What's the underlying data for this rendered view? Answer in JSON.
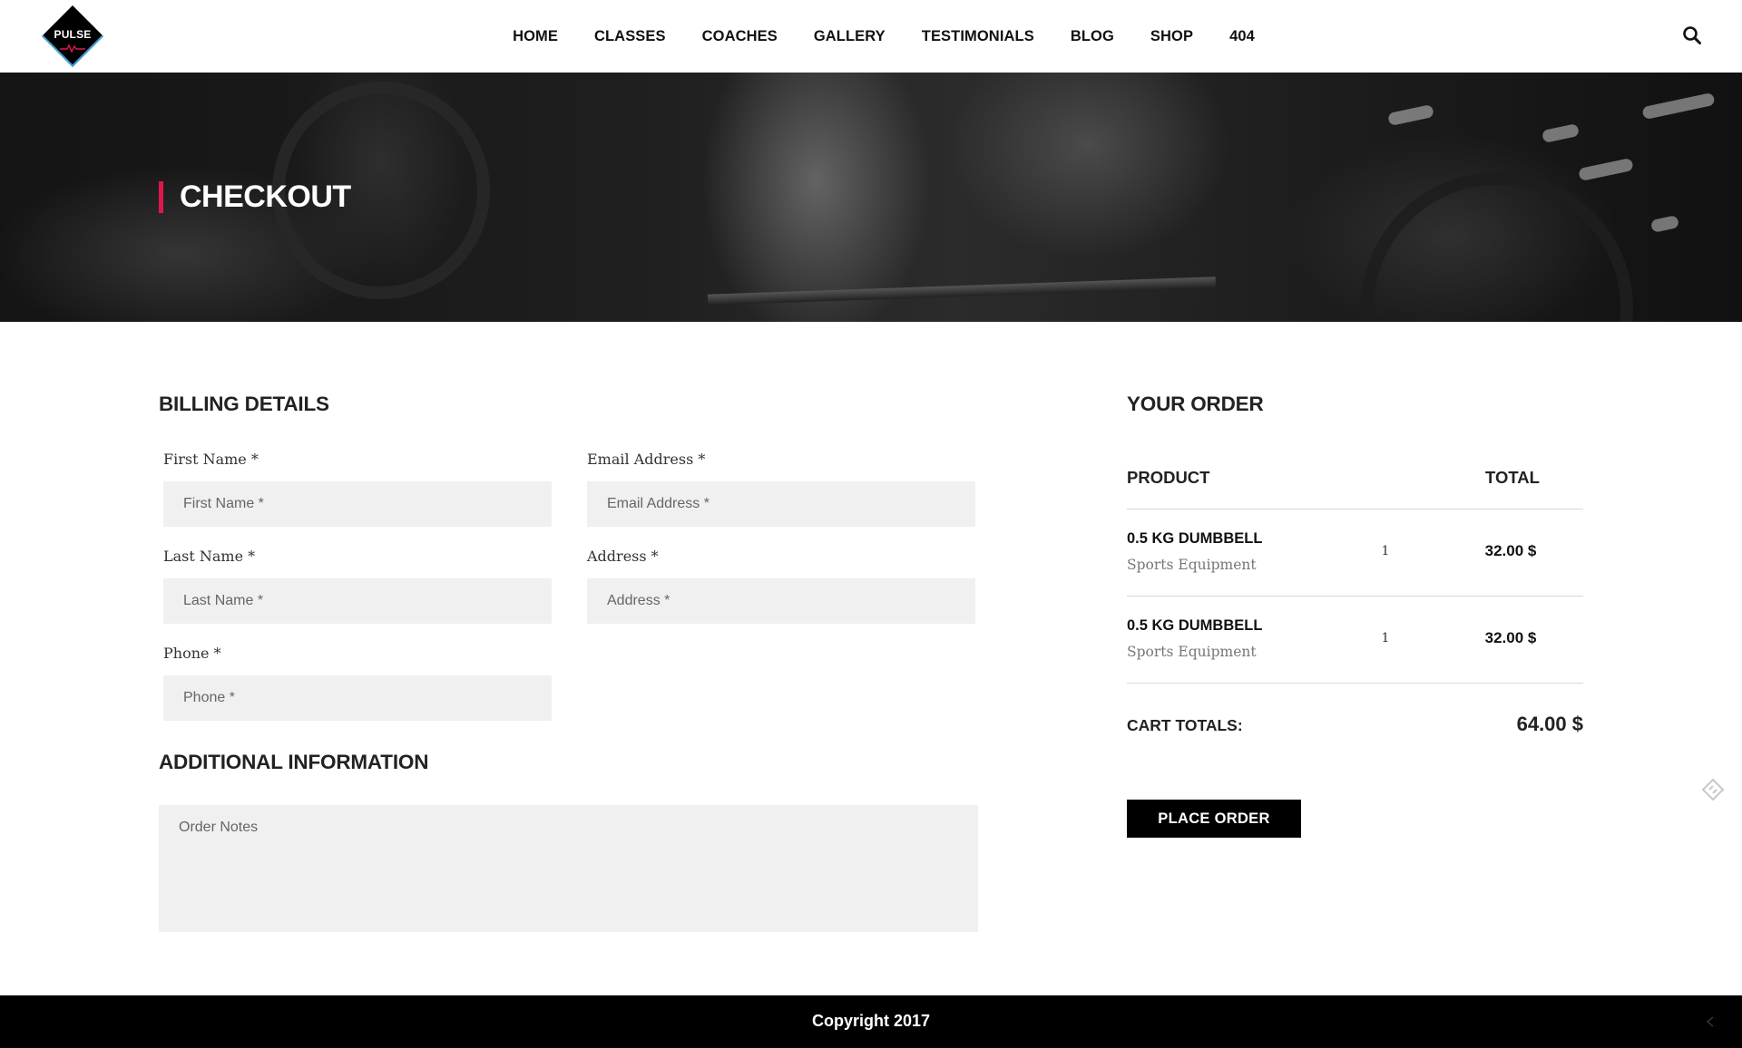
{
  "brand": {
    "logo_text": "PULSE"
  },
  "nav": {
    "items": [
      "HOME",
      "CLASSES",
      "COACHES",
      "GALLERY",
      "TESTIMONIALS",
      "BLOG",
      "SHOP",
      "404"
    ]
  },
  "hero": {
    "title": "CHECKOUT",
    "accent_color": "#e0174a"
  },
  "billing": {
    "heading": "BILLING DETAILS",
    "first_name": {
      "label": "First Name",
      "required_mark": "*",
      "placeholder": "First Name *",
      "value": ""
    },
    "email": {
      "label": "Email Address",
      "required_mark": "*",
      "placeholder": "Email Address *",
      "value": ""
    },
    "last_name": {
      "label": "Last Name",
      "required_mark": "*",
      "placeholder": "Last Name *",
      "value": ""
    },
    "address": {
      "label": "Address",
      "required_mark": "*",
      "placeholder": "Address *",
      "value": ""
    },
    "phone": {
      "label": "Phone",
      "required_mark": "*",
      "placeholder": "Phone *",
      "value": ""
    }
  },
  "additional": {
    "heading": "ADDITIONAL INFORMATION",
    "notes_placeholder": "Order Notes"
  },
  "order": {
    "heading": "YOUR ORDER",
    "col_product": "PRODUCT",
    "col_total": "TOTAL",
    "items": [
      {
        "name": "0.5 KG DUMBBELL",
        "category": "Sports Equipment",
        "qty": "1",
        "total": "32.00 $"
      },
      {
        "name": "0.5 KG DUMBBELL",
        "category": "Sports Equipment",
        "qty": "1",
        "total": "32.00 $"
      }
    ],
    "cart_totals_label": "CART TOTALS:",
    "cart_totals_value": "64.00 $",
    "place_order_label": "PLACE ORDER"
  },
  "footer": {
    "copyright": "Copyright 2017"
  },
  "icons": {
    "search": "search-icon",
    "logo_pulse": "heartbeat-icon",
    "floating": "tag-icon"
  }
}
